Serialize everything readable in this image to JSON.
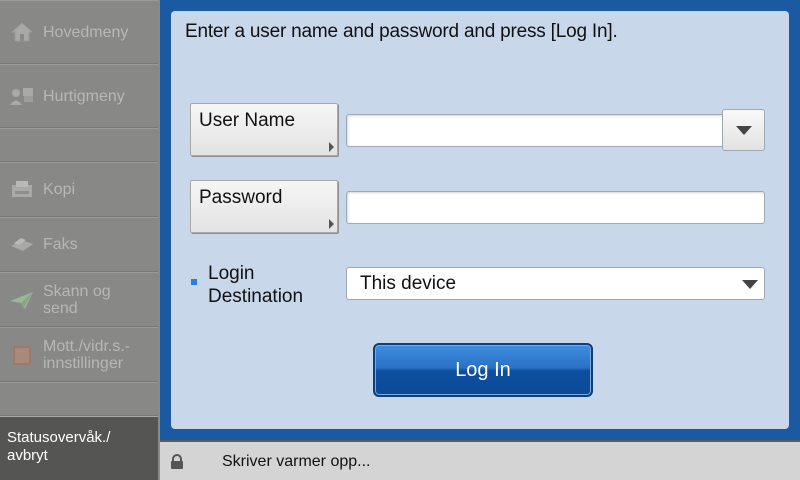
{
  "sidebar": {
    "items": [
      {
        "label": "Hovedmeny",
        "icon": "home-icon"
      },
      {
        "label": "Hurtigmeny",
        "icon": "quick-menu-icon"
      },
      {
        "label": "Kopi",
        "icon": "copy-icon"
      },
      {
        "label": "Faks",
        "icon": "fax-icon"
      },
      {
        "label": "Skann og send",
        "icon": "scan-send-icon"
      },
      {
        "label": "Mott./vidr.s.- innstillinger",
        "icon": "receive-forward-icon"
      }
    ],
    "status_button": "Statusovervåk./ avbryt"
  },
  "login": {
    "instruction": "Enter a user name and password and press [Log In].",
    "username_label": "User Name",
    "username_value": "",
    "password_label": "Password",
    "password_value": "",
    "destination_label": "Login Destination",
    "destination_value": "This device",
    "login_button": "Log In"
  },
  "statusbar": {
    "message": "Skriver varmer opp..."
  },
  "colors": {
    "panel_border": "#1b5aa0",
    "panel_bg": "#c9d7ea",
    "sidebar_bg": "#888886",
    "login_button": "#0d4f9f"
  }
}
